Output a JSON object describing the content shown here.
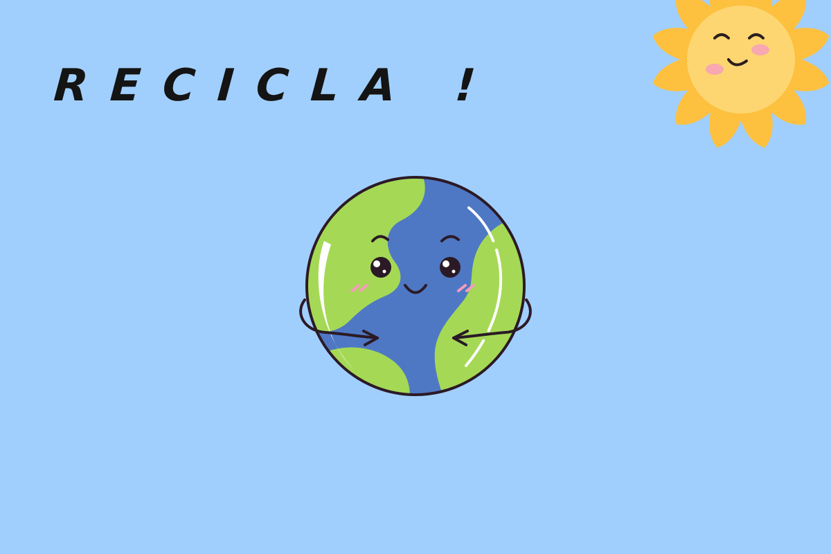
{
  "background_color": "#a1cffd",
  "headline": {
    "text": "RECICLA !",
    "color": "#141414"
  },
  "sun": {
    "icon": "smiling-sun-icon",
    "ray_color": "#fdc03f",
    "face_color": "#fdd671",
    "cheek_color": "#f7a8b0",
    "line_color": "#2a1e1e"
  },
  "earth": {
    "icon": "smiling-earth-hugging-icon",
    "ocean_color": "#4f78c4",
    "land_color": "#a5d955",
    "outline_color": "#2b1a26",
    "shine_color": "#ffffff",
    "cheek_color": "#f59bbc"
  }
}
